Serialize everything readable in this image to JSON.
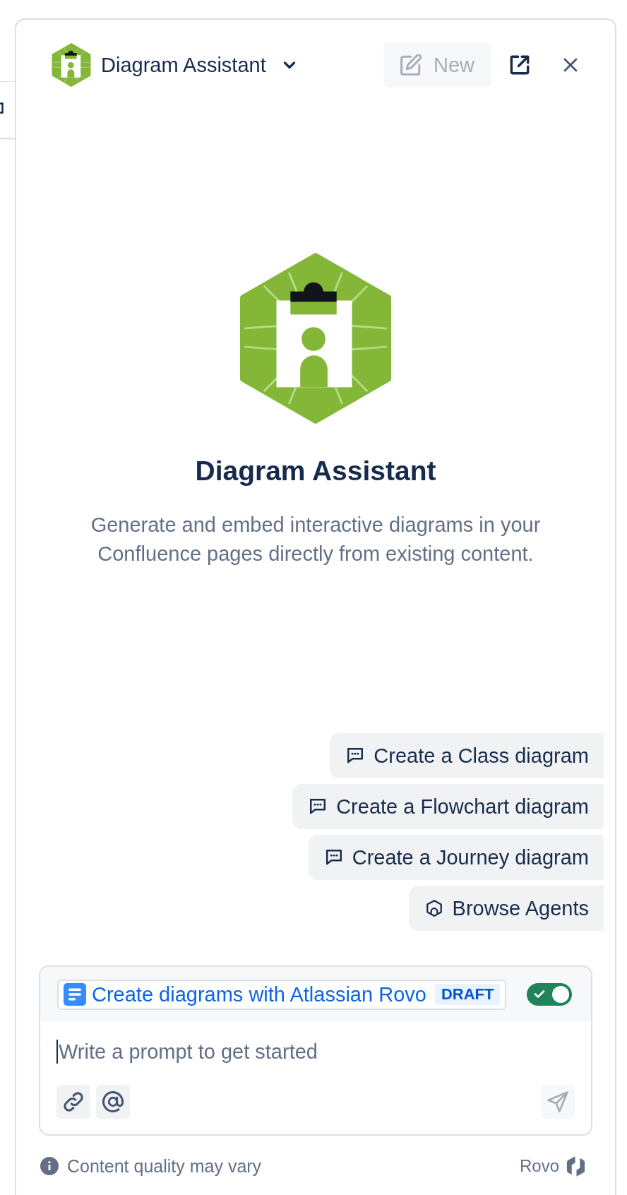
{
  "header": {
    "title": "Diagram Assistant",
    "new_button": {
      "label": "New",
      "disabled": true
    }
  },
  "hero": {
    "title": "Diagram Assistant",
    "description": "Generate and embed interactive diagrams in your Confluence pages directly from existing content."
  },
  "suggestions": [
    {
      "label": "Create a Class diagram",
      "kind": "prompt"
    },
    {
      "label": "Create a Flowchart diagram",
      "kind": "prompt"
    },
    {
      "label": "Create a Journey diagram",
      "kind": "prompt"
    },
    {
      "label": "Browse Agents",
      "kind": "browse"
    }
  ],
  "composer": {
    "page_link": {
      "title": "Create diagrams with Atlassian Rovo",
      "badge": "DRAFT"
    },
    "toggle": {
      "on": true
    },
    "placeholder": "Write a prompt to get started",
    "send": {
      "disabled": true
    }
  },
  "footer": {
    "notice": "Content quality may vary",
    "brand": "Rovo"
  }
}
